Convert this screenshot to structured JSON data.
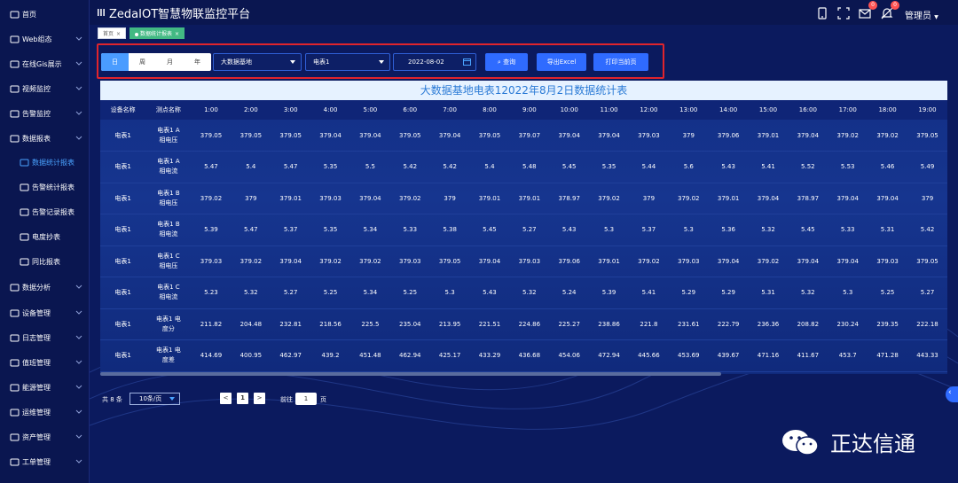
{
  "app": {
    "title": "ZedaIOT智慧物联监控平台",
    "user": "管理员",
    "mail_badge": "0",
    "alert_badge": "0"
  },
  "sidebar": {
    "items": [
      {
        "label": "首页",
        "icon": "home-icon",
        "level": 0,
        "chevron": false
      },
      {
        "label": "Web组态",
        "icon": "web-icon",
        "level": 0,
        "chevron": true
      },
      {
        "label": "在线Gis展示",
        "icon": "map-icon",
        "level": 0,
        "chevron": true
      },
      {
        "label": "视频监控",
        "icon": "video-icon",
        "level": 0,
        "chevron": true
      },
      {
        "label": "告警监控",
        "icon": "alarm-icon",
        "level": 0,
        "chevron": true
      },
      {
        "label": "数据报表",
        "icon": "report-icon",
        "level": 0,
        "chevron": true
      },
      {
        "label": "数据统计报表",
        "icon": "stats-icon",
        "level": 1,
        "active": true
      },
      {
        "label": "告警统计报表",
        "icon": "alarm-stats-icon",
        "level": 1
      },
      {
        "label": "告警记录报表",
        "icon": "alarm-record-icon",
        "level": 1
      },
      {
        "label": "电度抄表",
        "icon": "meter-icon",
        "level": 1
      },
      {
        "label": "同比报表",
        "icon": "compare-icon",
        "level": 1
      },
      {
        "label": "数据分析",
        "icon": "analysis-icon",
        "level": 0,
        "chevron": true
      },
      {
        "label": "设备管理",
        "icon": "device-icon",
        "level": 0,
        "chevron": true
      },
      {
        "label": "日志管理",
        "icon": "log-icon",
        "level": 0,
        "chevron": true
      },
      {
        "label": "值班管理",
        "icon": "duty-icon",
        "level": 0,
        "chevron": true
      },
      {
        "label": "能源管理",
        "icon": "energy-icon",
        "level": 0,
        "chevron": true
      },
      {
        "label": "运维管理",
        "icon": "ops-icon",
        "level": 0,
        "chevron": true
      },
      {
        "label": "资产管理",
        "icon": "asset-icon",
        "level": 0,
        "chevron": true
      },
      {
        "label": "工单管理",
        "icon": "ticket-icon",
        "level": 0,
        "chevron": true
      }
    ]
  },
  "tabs": [
    {
      "label": "首页",
      "close": "×"
    },
    {
      "label": "数据统计报表",
      "close": "×",
      "active": true
    }
  ],
  "filter": {
    "periods": [
      "日",
      "周",
      "月",
      "年"
    ],
    "site": "大数据基地",
    "meter": "电表1",
    "date": "2022-08-02",
    "query_label": "查询",
    "export_label": "导出Excel",
    "print_label": "打印当前页"
  },
  "table": {
    "title": "大数据基地电表12022年8月2日数据统计表",
    "headers": [
      "设备名称",
      "测点名称",
      "1:00",
      "2:00",
      "3:00",
      "4:00",
      "5:00",
      "6:00",
      "7:00",
      "8:00",
      "9:00",
      "10:00",
      "11:00",
      "12:00",
      "13:00",
      "14:00",
      "15:00",
      "16:00",
      "17:00",
      "18:00",
      "19:00"
    ],
    "rows": [
      {
        "device": "电表1",
        "point1": "电表1 A",
        "point2": "相电压",
        "values": [
          "379.05",
          "379.05",
          "379.05",
          "379.04",
          "379.04",
          "379.05",
          "379.04",
          "379.05",
          "379.07",
          "379.04",
          "379.04",
          "379.03",
          "379",
          "379.06",
          "379.01",
          "379.04",
          "379.02",
          "379.02",
          "379.05"
        ]
      },
      {
        "device": "电表1",
        "point1": "电表1 A",
        "point2": "相电流",
        "values": [
          "5.47",
          "5.4",
          "5.47",
          "5.35",
          "5.5",
          "5.42",
          "5.42",
          "5.4",
          "5.48",
          "5.45",
          "5.35",
          "5.44",
          "5.6",
          "5.43",
          "5.41",
          "5.52",
          "5.53",
          "5.46",
          "5.49"
        ]
      },
      {
        "device": "电表1",
        "point1": "电表1 B",
        "point2": "相电压",
        "values": [
          "379.02",
          "379",
          "379.01",
          "379.03",
          "379.04",
          "379.02",
          "379",
          "379.01",
          "379.01",
          "378.97",
          "379.02",
          "379",
          "379.02",
          "379.01",
          "379.04",
          "378.97",
          "379.04",
          "379.04",
          "379"
        ]
      },
      {
        "device": "电表1",
        "point1": "电表1 B",
        "point2": "相电流",
        "values": [
          "5.39",
          "5.47",
          "5.37",
          "5.35",
          "5.34",
          "5.33",
          "5.38",
          "5.45",
          "5.27",
          "5.43",
          "5.3",
          "5.37",
          "5.3",
          "5.36",
          "5.32",
          "5.45",
          "5.33",
          "5.31",
          "5.42"
        ]
      },
      {
        "device": "电表1",
        "point1": "电表1 C",
        "point2": "相电压",
        "values": [
          "379.03",
          "379.02",
          "379.04",
          "379.02",
          "379.02",
          "379.03",
          "379.05",
          "379.04",
          "379.03",
          "379.06",
          "379.01",
          "379.02",
          "379.03",
          "379.04",
          "379.02",
          "379.04",
          "379.04",
          "379.03",
          "379.05"
        ]
      },
      {
        "device": "电表1",
        "point1": "电表1 C",
        "point2": "相电流",
        "values": [
          "5.23",
          "5.32",
          "5.27",
          "5.25",
          "5.34",
          "5.25",
          "5.3",
          "5.43",
          "5.32",
          "5.24",
          "5.39",
          "5.41",
          "5.29",
          "5.29",
          "5.31",
          "5.32",
          "5.3",
          "5.25",
          "5.27"
        ]
      },
      {
        "device": "电表1",
        "point1": "电表1 电",
        "point2": "度分",
        "values": [
          "211.82",
          "204.48",
          "232.81",
          "218.56",
          "225.5",
          "235.04",
          "213.95",
          "221.51",
          "224.86",
          "225.27",
          "238.86",
          "221.8",
          "231.61",
          "222.79",
          "236.36",
          "208.82",
          "230.24",
          "239.35",
          "222.18"
        ]
      },
      {
        "device": "电表1",
        "point1": "电表1 电",
        "point2": "度差",
        "values": [
          "414.69",
          "400.95",
          "462.97",
          "439.2",
          "451.48",
          "462.94",
          "425.17",
          "433.29",
          "436.68",
          "454.06",
          "472.94",
          "445.66",
          "453.69",
          "439.67",
          "471.16",
          "411.67",
          "453.7",
          "471.28",
          "443.33"
        ]
      }
    ]
  },
  "pagination": {
    "total": "共 8 条",
    "page_size": "10条/页",
    "prev": "<",
    "current": "1",
    "next": ">",
    "goto_label": "前往",
    "goto_value": "1",
    "unit": "页"
  },
  "watermark": {
    "text": "正达信通"
  }
}
